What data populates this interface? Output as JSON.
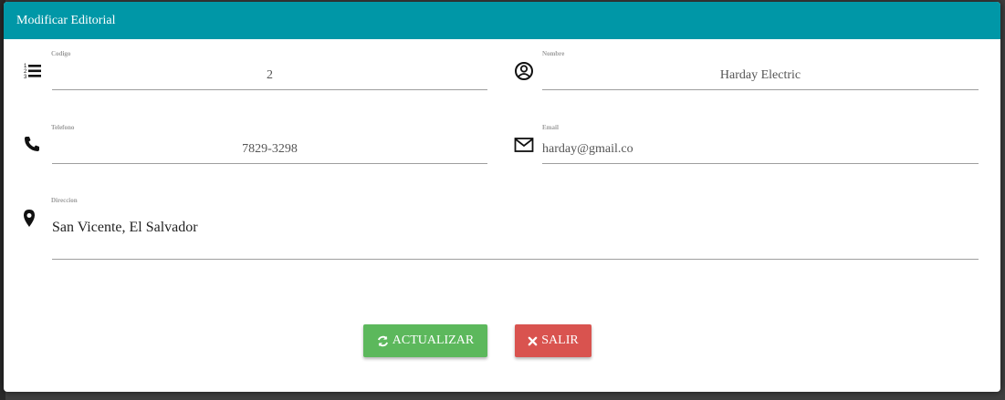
{
  "modal": {
    "title": "Modificar Editorial"
  },
  "fields": {
    "codigo": {
      "label": "Codigo",
      "value": "2",
      "icon": "list-ol-icon"
    },
    "nombre": {
      "label": "Nombre",
      "value": "Harday Electric",
      "icon": "user-circle-icon"
    },
    "telefono": {
      "label": "Telefono",
      "value": "7829-3298",
      "icon": "phone-icon"
    },
    "email": {
      "label": "Email",
      "value": "harday@gmail.co",
      "icon": "envelope-icon"
    },
    "direccion": {
      "label": "Direccion",
      "value": "San Vicente, El Salvador",
      "icon": "map-marker-icon"
    }
  },
  "buttons": {
    "update_label": "ACTUALIZAR",
    "exit_label": "SALIR"
  },
  "colors": {
    "header": "#0097a7",
    "update_button": "#5cb85c",
    "exit_button": "#d9534f"
  }
}
